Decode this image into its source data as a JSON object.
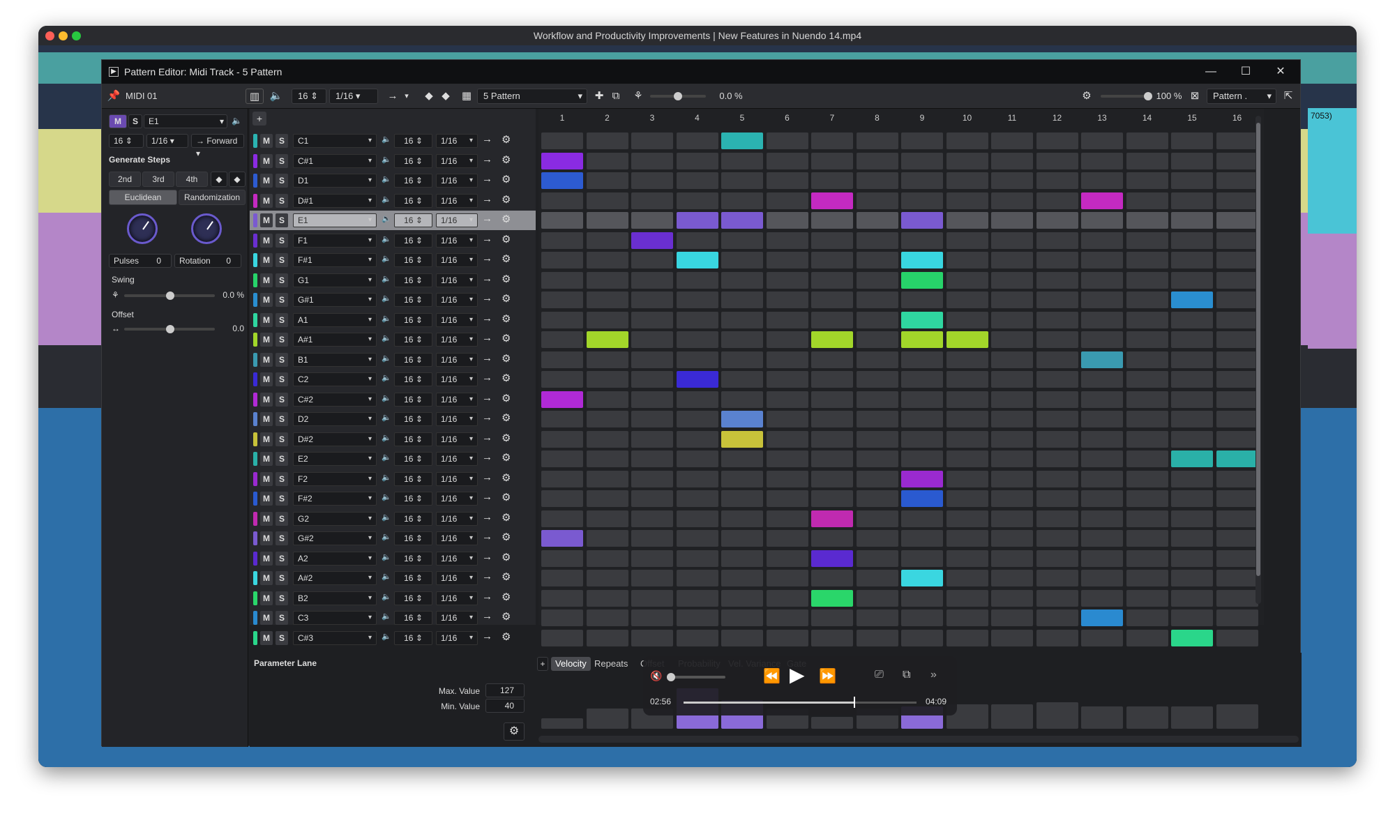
{
  "os_window": {
    "title": "Workflow and Productivity Improvements | New Features in Nuendo 14.mp4"
  },
  "editor": {
    "title": "Pattern Editor: Midi Track - 5 Pattern"
  },
  "toolbar": {
    "track_name": "MIDI 01",
    "steps": "16",
    "resolution": "1/16",
    "pattern_name": "5 Pattern",
    "swing_value": "0.0 %",
    "zoom_value": "100 %",
    "pattern_dropdown": "Pattern ."
  },
  "left_panel": {
    "lane_note": "E1",
    "steps": "16",
    "resolution": "1/16",
    "direction": "Forward",
    "generate_title": "Generate Steps",
    "gen_buttons": [
      "2nd",
      "3rd",
      "4th"
    ],
    "mode_tabs": [
      "Euclidean",
      "Randomization"
    ],
    "pulses_label": "Pulses",
    "pulses_value": "0",
    "rotation_label": "Rotation",
    "rotation_value": "0",
    "swing_label": "Swing",
    "swing_value": "0.0 %",
    "offset_label": "Offset",
    "offset_value": "0.0"
  },
  "track_defaults": {
    "mute": "M",
    "solo": "S",
    "steps": "16",
    "resolution": "1/16"
  },
  "track_lanes": [
    {
      "note": "C1",
      "color": "#2bb3b1"
    },
    {
      "note": "C#1",
      "color": "#8a2be2"
    },
    {
      "note": "D1",
      "color": "#2d5bd1"
    },
    {
      "note": "D#1",
      "color": "#c42ac2"
    },
    {
      "note": "E1",
      "color": "#7a5ad0",
      "selected": true
    },
    {
      "note": "F1",
      "color": "#6a2fd0"
    },
    {
      "note": "F#1",
      "color": "#39d6e0"
    },
    {
      "note": "G1",
      "color": "#27d36a"
    },
    {
      "note": "G#1",
      "color": "#2a8ed0"
    },
    {
      "note": "A1",
      "color": "#2fd6a0"
    },
    {
      "note": "A#1",
      "color": "#a2d62a"
    },
    {
      "note": "B1",
      "color": "#3a9ab0"
    },
    {
      "note": "C2",
      "color": "#3a2ad6"
    },
    {
      "note": "C#2",
      "color": "#b02ad6"
    },
    {
      "note": "D2",
      "color": "#5a82d0"
    },
    {
      "note": "D#2",
      "color": "#c8c23a"
    },
    {
      "note": "E2",
      "color": "#2ab0a8"
    },
    {
      "note": "F2",
      "color": "#9a2ad0"
    },
    {
      "note": "F#2",
      "color": "#2a5ad0"
    },
    {
      "note": "G2",
      "color": "#c02ab0"
    },
    {
      "note": "G#2",
      "color": "#7a5ad0"
    },
    {
      "note": "A2",
      "color": "#5a2ad0"
    },
    {
      "note": "A#2",
      "color": "#3ad6e0"
    },
    {
      "note": "B2",
      "color": "#2ad66a"
    },
    {
      "note": "C3",
      "color": "#2a8ad0"
    },
    {
      "note": "C#3",
      "color": "#2ad68a"
    }
  ],
  "step_numbers": [
    "1",
    "2",
    "3",
    "4",
    "5",
    "6",
    "7",
    "8",
    "9",
    "10",
    "11",
    "12",
    "13",
    "14",
    "15",
    "16"
  ],
  "active_steps": [
    [
      0,
      4
    ],
    [
      1,
      0
    ],
    [
      2,
      0
    ],
    [
      3,
      6
    ],
    [
      3,
      12
    ],
    [
      4,
      3
    ],
    [
      4,
      4
    ],
    [
      4,
      8
    ],
    [
      5,
      2
    ],
    [
      6,
      3
    ],
    [
      6,
      8
    ],
    [
      7,
      8
    ],
    [
      8,
      14
    ],
    [
      9,
      8
    ],
    [
      10,
      1
    ],
    [
      10,
      6
    ],
    [
      10,
      8
    ],
    [
      10,
      9
    ],
    [
      11,
      12
    ],
    [
      12,
      3
    ],
    [
      13,
      0
    ],
    [
      14,
      4
    ],
    [
      15,
      4
    ],
    [
      16,
      14
    ],
    [
      16,
      15
    ],
    [
      17,
      8
    ],
    [
      18,
      8
    ],
    [
      19,
      6
    ],
    [
      20,
      0
    ],
    [
      21,
      6
    ],
    [
      22,
      8
    ],
    [
      23,
      6
    ],
    [
      24,
      12
    ],
    [
      25,
      14
    ]
  ],
  "transport": {
    "current_time": "02:56",
    "total_time": "04:09",
    "progress": 0.73
  },
  "parameter_lane": {
    "label": "Parameter Lane",
    "tabs": [
      "Velocity",
      "Repeats",
      "Offset",
      "Probability",
      "Vel. Variance",
      "Gate"
    ],
    "active_tab": "Velocity",
    "max_label": "Max. Value",
    "max_value": "127",
    "min_label": "Min. Value",
    "min_value": "40",
    "velocities": [
      0.25,
      0.5,
      0.5,
      1.0,
      0.7,
      0.5,
      0.3,
      0.5,
      0.55,
      0.6,
      0.6,
      0.65,
      0.55,
      0.55,
      0.55,
      0.6
    ]
  },
  "arrange": {
    "track_label": "7053)"
  },
  "colors": {
    "accent": "#8a6ad8",
    "selected_lane": "#8e8f94",
    "empty_step": "#3a3b3f",
    "editor_bg": "#1e1f22"
  }
}
